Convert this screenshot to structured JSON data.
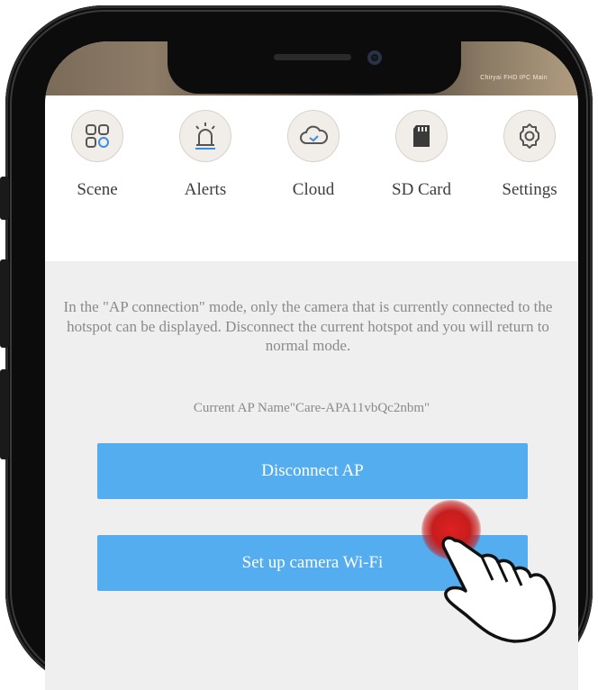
{
  "status_bar": {
    "text": "Chiryai FHD IPC Main"
  },
  "toolbar": {
    "items": [
      {
        "label": "Scene",
        "icon": "scene-grid-icon"
      },
      {
        "label": "Alerts",
        "icon": "alarm-light-icon"
      },
      {
        "label": "Cloud",
        "icon": "cloud-icon"
      },
      {
        "label": "SD Card",
        "icon": "sd-card-icon"
      },
      {
        "label": "Settings",
        "icon": "gear-icon"
      }
    ]
  },
  "ap_notice": {
    "message": "In the \"AP connection\" mode, only the camera that is currently connected to the hotspot can be displayed. Disconnect the current hotspot and you will return to normal mode.",
    "current_ap": "Current AP Name\"Care-APA11vbQc2nbm\""
  },
  "buttons": {
    "disconnect": "Disconnect AP",
    "setup_wifi": "Set up camera Wi-Fi"
  },
  "colors": {
    "button_blue": "#53adef",
    "background_gray": "#efefef",
    "tap_red": "#d21f1f",
    "icon_blue": "#3d8de0"
  }
}
